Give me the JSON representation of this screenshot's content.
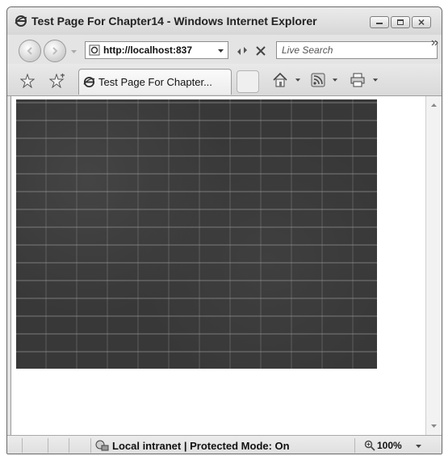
{
  "window": {
    "title": "Test Page For Chapter14 - Windows Internet Explorer",
    "title_icon": "ie-icon",
    "controls": [
      "minimize-icon",
      "maximize-icon",
      "close-icon"
    ]
  },
  "nav": {
    "back_icon": "back-arrow-icon",
    "forward_icon": "forward-arrow-icon",
    "address": "http://localhost:837",
    "search_placeholder": "Live Search",
    "extra_icon": "chevron-right-double-icon"
  },
  "tabbar": {
    "tab_label": "Test Page For Chapter...",
    "icons": [
      "favorites-star-icon",
      "add-favorites-icon",
      "home-icon",
      "rss-feed-icon",
      "print-icon"
    ]
  },
  "content": {
    "image_description_icon": "brick-wall-image"
  },
  "status": {
    "zone_text": "Local intranet | Protected Mode: On",
    "zoom": "100%"
  },
  "colors": {
    "chrome_bg": "#e4e4e4",
    "page_bg": "#ffffff",
    "brick": "#383838"
  }
}
